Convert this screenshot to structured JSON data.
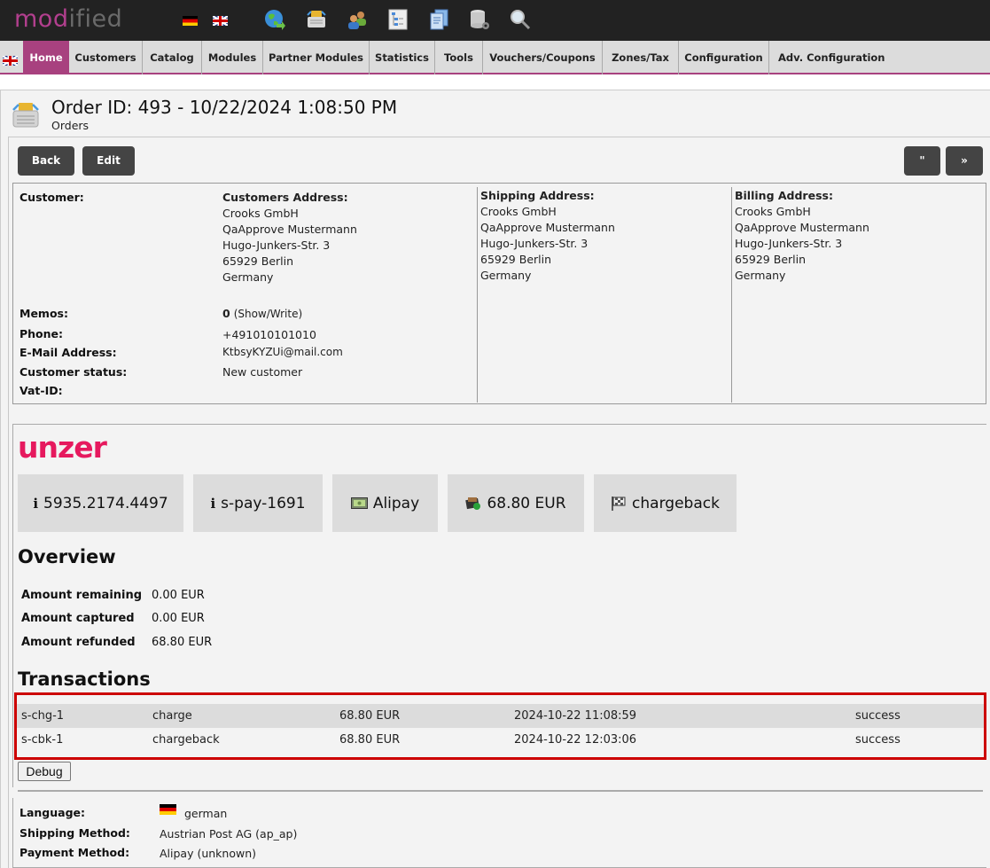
{
  "topbar": {
    "logo_mod": "mod",
    "logo_rest": "ified",
    "languages": [
      "german",
      "english"
    ],
    "icons": [
      "globe-icon",
      "basket-icon",
      "customers-icon",
      "sitemap-icon",
      "documents-icon",
      "database-icon",
      "search-icon"
    ]
  },
  "nav": {
    "items": [
      {
        "label": "Home",
        "active": true
      },
      {
        "label": "Customers"
      },
      {
        "label": "Catalog"
      },
      {
        "label": "Modules"
      },
      {
        "label": "Partner Modules"
      },
      {
        "label": "Statistics"
      },
      {
        "label": "Tools"
      },
      {
        "label": "Vouchers/Coupons"
      },
      {
        "label": "Zones/Tax"
      },
      {
        "label": "Configuration"
      },
      {
        "label": "Adv. Configuration"
      }
    ],
    "accent_color": "#a8417f"
  },
  "header": {
    "title": "Order ID: 493 - 10/22/2024 1:08:50 PM",
    "subtitle": "Orders"
  },
  "toolbar": {
    "back_label": "Back",
    "edit_label": "Edit",
    "prev_label": "\"",
    "next_label": "»"
  },
  "customer": {
    "customer_label": "Customer:",
    "customers_address_label": "Customers Address:",
    "customers_address": [
      "Crooks GmbH",
      "QaApprove Mustermann",
      "Hugo-Junkers-Str. 3",
      "65929 Berlin",
      "Germany"
    ],
    "memos_label": "Memos:",
    "memos_count": "0",
    "memos_link": "(Show/Write)",
    "phone_label": "Phone:",
    "phone": "+491010101010",
    "email_label": "E-Mail Address:",
    "email": "KtbsyKYZUi@mail.com",
    "status_label": "Customer status:",
    "status": "New customer",
    "vat_label": "Vat-ID:",
    "vat": ""
  },
  "shipping": {
    "label": "Shipping Address:",
    "lines": [
      "Crooks GmbH",
      "QaApprove Mustermann",
      "Hugo-Junkers-Str. 3",
      "65929 Berlin",
      "Germany"
    ]
  },
  "billing": {
    "label": "Billing Address:",
    "lines": [
      "Crooks GmbH",
      "QaApprove Mustermann",
      "Hugo-Junkers-Str. 3",
      "65929 Berlin",
      "Germany"
    ]
  },
  "unzer": {
    "logo": "unzer",
    "brand_color": "#e6195e",
    "tiles": [
      {
        "icon": "info-icon",
        "glyph": "i",
        "text": "5935.2174.4497"
      },
      {
        "icon": "info-icon",
        "glyph": "i",
        "text": "s-pay-1691"
      },
      {
        "icon": "payment-card-icon",
        "glyph": "",
        "text": "Alipay"
      },
      {
        "icon": "money-icon",
        "glyph": "",
        "text": "68.80 EUR"
      },
      {
        "icon": "flag-icon",
        "glyph": "",
        "text": "chargeback"
      }
    ],
    "overview_title": "Overview",
    "overview": [
      {
        "label": "Amount remaining",
        "value": "0.00 EUR"
      },
      {
        "label": "Amount captured",
        "value": "0.00 EUR"
      },
      {
        "label": "Amount refunded",
        "value": "68.80 EUR"
      }
    ],
    "transactions_title": "Transactions",
    "transactions": [
      {
        "id": "s-chg-1",
        "type": "charge",
        "amount": "68.80 EUR",
        "date": "2024-10-22 11:08:59",
        "status": "success"
      },
      {
        "id": "s-cbk-1",
        "type": "chargeback",
        "amount": "68.80 EUR",
        "date": "2024-10-22 12:03:06",
        "status": "success"
      }
    ],
    "debug_label": "Debug"
  },
  "order_meta": {
    "language_label": "Language:",
    "language": "german",
    "shipping_label": "Shipping Method:",
    "shipping": "Austrian Post AG (ap_ap)",
    "payment_label": "Payment Method:",
    "payment": "Alipay (unknown)"
  }
}
